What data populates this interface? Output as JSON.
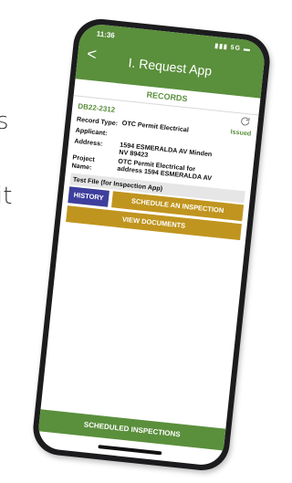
{
  "background_text": {
    "top": "s",
    "bottom": "it"
  },
  "status_bar": {
    "time": "11:36",
    "signal": "5G"
  },
  "header": {
    "back": "<",
    "title": "I. Request App"
  },
  "tab": {
    "label": "RECORDS"
  },
  "record": {
    "id": "DB22-2312",
    "status": "Issued",
    "fields": {
      "record_type_label": "Record Type:",
      "record_type_value": "OTC Permit Electrical",
      "applicant_label": "Applicant:",
      "address_label": "Address:",
      "address_value": "1594 ESMERALDA AV Minden NV 89423",
      "project_name_label": "Project Name:",
      "project_name_value": "OTC Permit Electrical for address 1594 ESMERALDA AV"
    },
    "test_file": "Test File (for Inspection App)"
  },
  "buttons": {
    "history": "HISTORY",
    "schedule": "SCHEDULE AN INSPECTION",
    "documents": "VIEW DOCUMENTS"
  },
  "footer": {
    "label": "SCHEDULED INSPECTIONS"
  },
  "colors": {
    "brand_green": "#5a8f3c",
    "history_blue": "#3e3f9c",
    "action_gold": "#c0951f"
  }
}
